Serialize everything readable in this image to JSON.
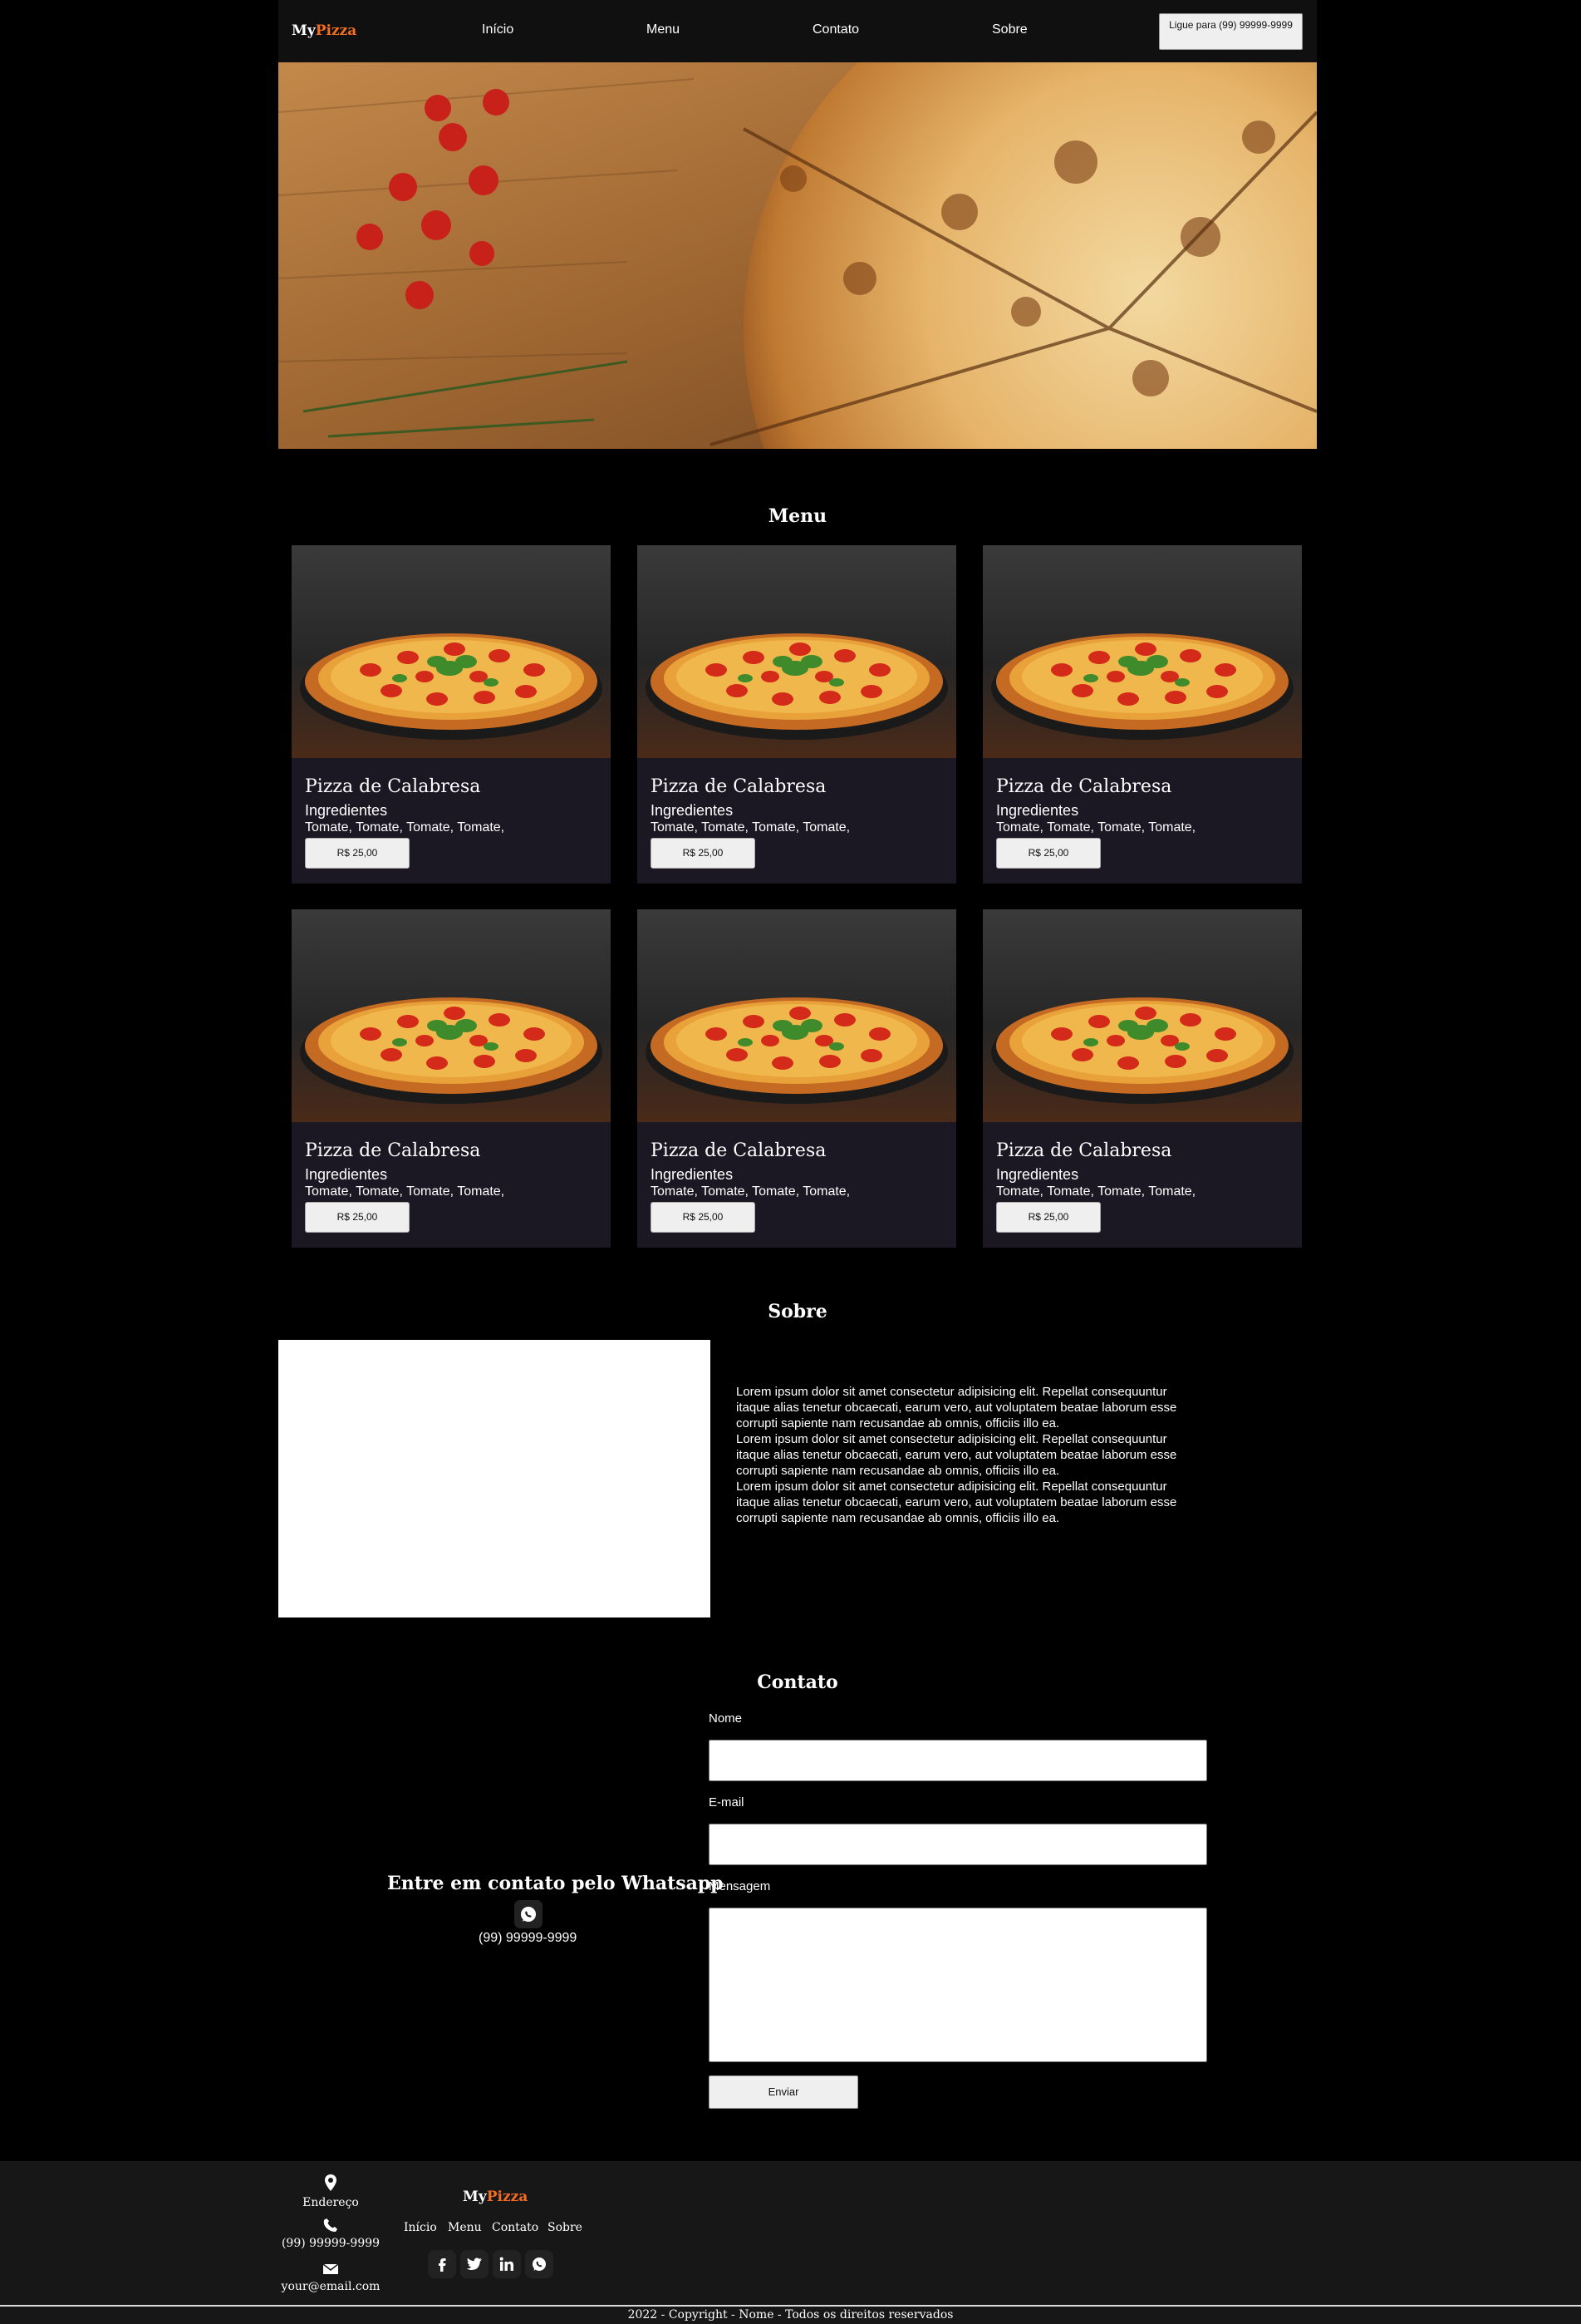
{
  "header": {
    "logo_my": "My",
    "logo_pizza": "Pizza",
    "nav": [
      "Início",
      "Menu",
      "Contato",
      "Sobre"
    ],
    "call_button": "Ligue para (99) 99999-9999"
  },
  "menu": {
    "title": "Menu",
    "items": [
      {
        "name": "Pizza de Calabresa",
        "ingredients_title": "Ingredientes",
        "ingredients": "Tomate, Tomate, Tomate, Tomate,",
        "price": "R$ 25,00"
      },
      {
        "name": "Pizza de Calabresa",
        "ingredients_title": "Ingredientes",
        "ingredients": "Tomate, Tomate, Tomate, Tomate,",
        "price": "R$ 25,00"
      },
      {
        "name": "Pizza de Calabresa",
        "ingredients_title": "Ingredientes",
        "ingredients": "Tomate, Tomate, Tomate, Tomate,",
        "price": "R$ 25,00"
      },
      {
        "name": "Pizza de Calabresa",
        "ingredients_title": "Ingredientes",
        "ingredients": "Tomate, Tomate, Tomate, Tomate,",
        "price": "R$ 25,00"
      },
      {
        "name": "Pizza de Calabresa",
        "ingredients_title": "Ingredientes",
        "ingredients": "Tomate, Tomate, Tomate, Tomate,",
        "price": "R$ 25,00"
      },
      {
        "name": "Pizza de Calabresa",
        "ingredients_title": "Ingredientes",
        "ingredients": "Tomate, Tomate, Tomate, Tomate,",
        "price": "R$ 25,00"
      }
    ]
  },
  "about": {
    "title": "Sobre",
    "paragraphs": [
      "Lorem ipsum dolor sit amet consectetur adipisicing elit. Repellat consequuntur itaque alias tenetur obcaecati, earum vero, aut voluptatem beatae laborum esse corrupti sapiente nam recusandae ab omnis, officiis illo ea.",
      "Lorem ipsum dolor sit amet consectetur adipisicing elit. Repellat consequuntur itaque alias tenetur obcaecati, earum vero, aut voluptatem beatae laborum esse corrupti sapiente nam recusandae ab omnis, officiis illo ea.",
      "Lorem ipsum dolor sit amet consectetur adipisicing elit. Repellat consequuntur itaque alias tenetur obcaecati, earum vero, aut voluptatem beatae laborum esse corrupti sapiente nam recusandae ab omnis, officiis illo ea."
    ]
  },
  "contact": {
    "title": "Contato",
    "whatsapp_title": "Entre em contato pelo Whatsapp",
    "whatsapp_phone": "(99) 99999-9999",
    "name_label": "Nome",
    "name_value": "",
    "email_label": "E-mail",
    "email_value": "",
    "message_label": "Mensagem",
    "message_value": "",
    "send_button": "Enviar"
  },
  "footer": {
    "address_label": "Endereço",
    "phone": "(99) 99999-9999",
    "email": "your@email.com",
    "logo_my": "My",
    "logo_pizza": "Pizza",
    "nav": [
      "Início",
      "Menu",
      "Contato",
      "Sobre"
    ],
    "social_icons": [
      "facebook-icon",
      "twitter-icon",
      "linkedin-icon",
      "whatsapp-icon"
    ],
    "copyright": "2022 - Copyright - Nome - Todos os direitos reservados"
  },
  "colors": {
    "accent": "#f26c21",
    "card_bg": "#1b1823",
    "footer_bg": "#171717",
    "header_bg": "#101010"
  }
}
